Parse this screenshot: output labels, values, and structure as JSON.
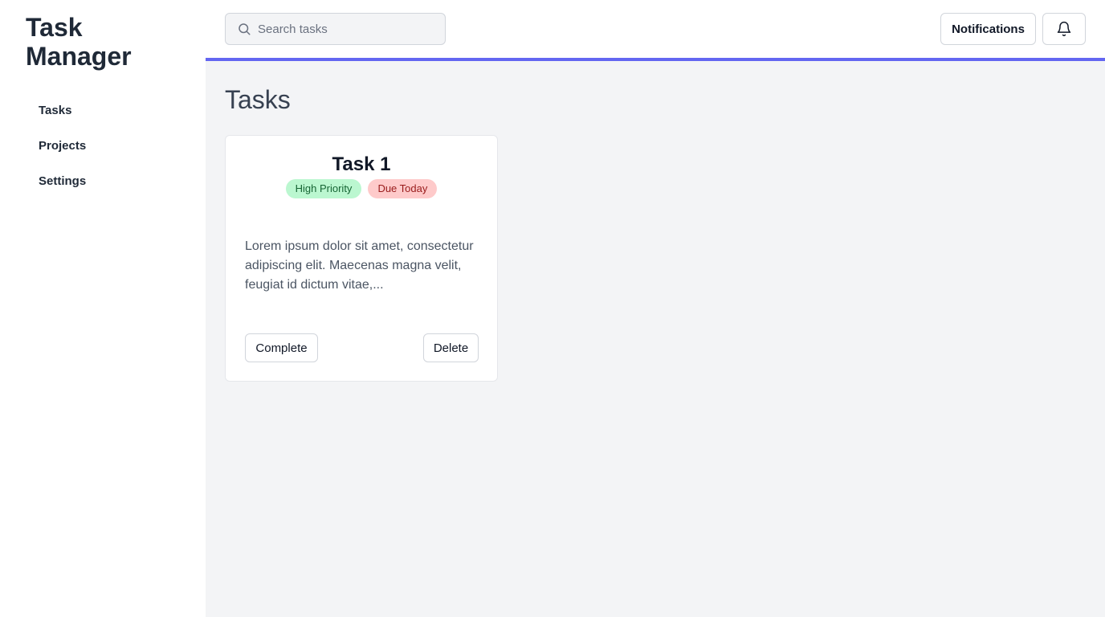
{
  "app": {
    "title": "Task Manager"
  },
  "sidebar": {
    "items": [
      {
        "label": "Tasks"
      },
      {
        "label": "Projects"
      },
      {
        "label": "Settings"
      }
    ]
  },
  "header": {
    "search_placeholder": "Search tasks",
    "search_value": "",
    "notifications_label": "Notifications",
    "bell_icon": "bell-icon",
    "accent_color": "#6366f1"
  },
  "main": {
    "title": "Tasks",
    "tasks": [
      {
        "title": "Task 1",
        "badges": [
          {
            "label": "High Priority",
            "color": "#bbf7d0"
          },
          {
            "label": "Due Today",
            "color": "#fecaca"
          }
        ],
        "description": "Lorem ipsum dolor sit amet, consectetur adipiscing elit. Maecenas magna velit, feugiat id dictum vitae,...",
        "complete_label": "Complete",
        "delete_label": "Delete"
      }
    ]
  }
}
